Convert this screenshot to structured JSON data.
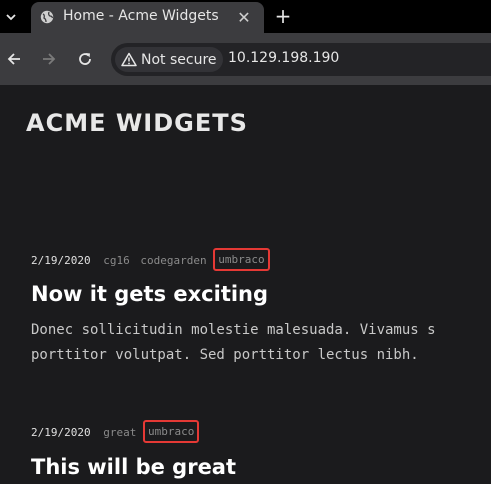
{
  "browser": {
    "tab": {
      "title": "Home - Acme Widgets",
      "favicon": "globe-icon",
      "close_glyph": "✕"
    },
    "new_tab_glyph": "+",
    "tab_dropdown_glyph": "⌄",
    "toolbar": {
      "back_icon": "back-arrow-icon",
      "forward_icon": "forward-arrow-icon",
      "reload_icon": "reload-icon"
    },
    "omnibox": {
      "security_icon": "warning-triangle-icon",
      "security_label": "Not secure",
      "url": "10.129.198.190"
    }
  },
  "page": {
    "site_title": "ACME WIDGETS",
    "posts": [
      {
        "date": "2/19/2020",
        "tags": [
          "cg16",
          "codegarden"
        ],
        "highlighted_tag": "umbraco",
        "title": "Now it gets exciting",
        "excerpt_line1": "Donec sollicitudin molestie malesuada. Vivamus s",
        "excerpt_line2": "porttitor volutpat. Sed porttitor lectus nibh."
      },
      {
        "date": "2/19/2020",
        "tags": [
          "great"
        ],
        "highlighted_tag": "umbraco",
        "title": "This will be great"
      }
    ]
  },
  "colors": {
    "tabstrip_bg": "#000000",
    "toolbar_bg": "#3c3c3f",
    "page_bg": "#1b1b1d",
    "highlight_border": "#e53935"
  }
}
